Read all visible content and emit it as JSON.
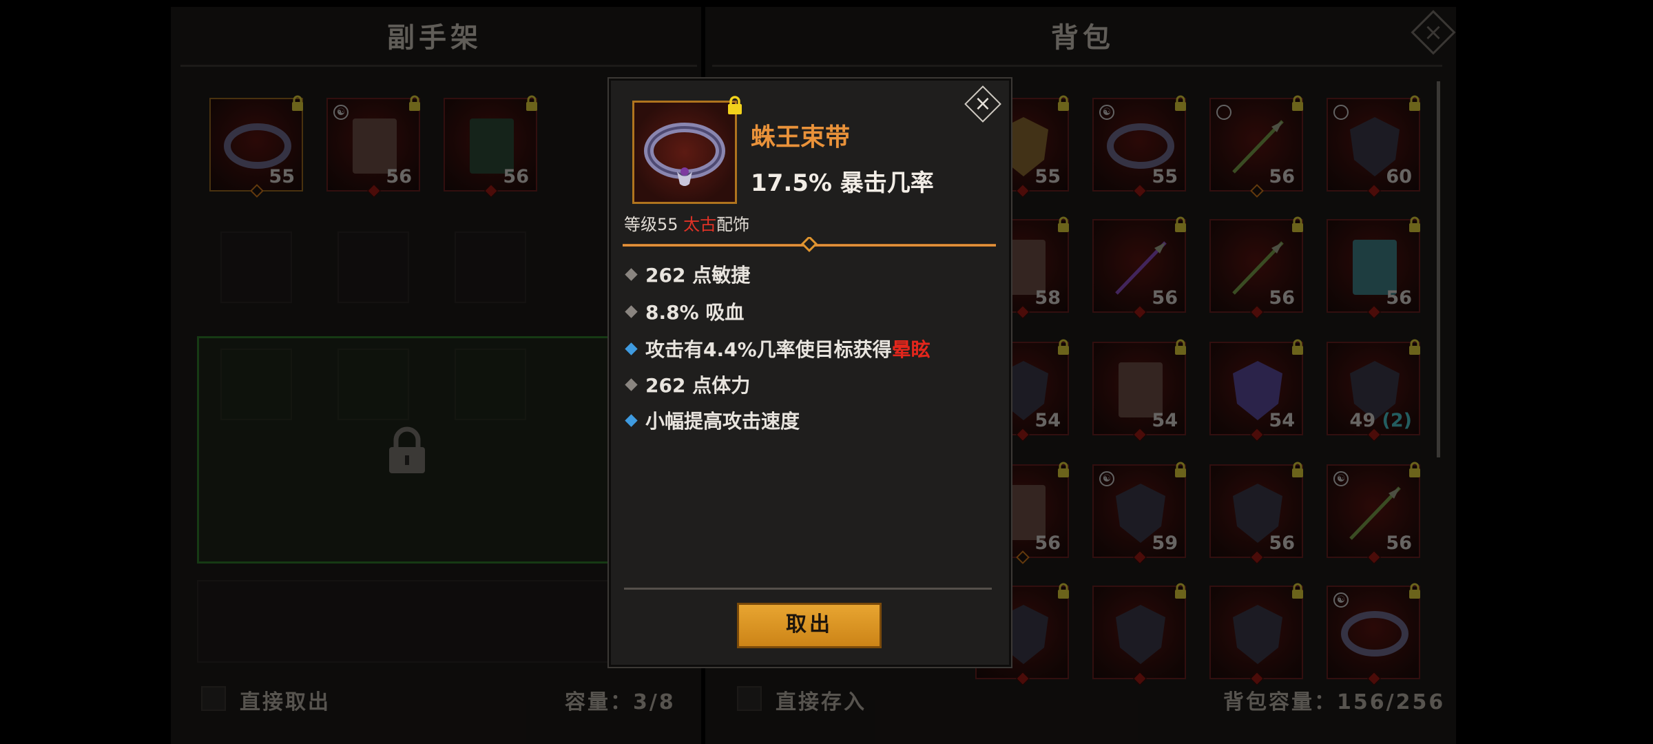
{
  "left_panel": {
    "title": "副手架",
    "items": [
      {
        "level": "55",
        "icon": "belt-icon",
        "lock": true,
        "diamond": "gold",
        "frame": "gold"
      },
      {
        "level": "56",
        "icon": "tome-icon",
        "lock": true,
        "diamond": "red",
        "yinyang": true
      },
      {
        "level": "56",
        "icon": "green-tome-icon",
        "lock": true,
        "diamond": "red"
      }
    ],
    "direct_take_label": "直接取出",
    "capacity_label": "容量：3/8",
    "locked_area_icon": "padlock-icon"
  },
  "right_panel": {
    "title": "背包",
    "rows": [
      [
        {
          "level": "55",
          "icon": "gold-armor-icon"
        },
        {
          "level": "55",
          "icon": "belt-icon",
          "yinyang": true
        },
        {
          "level": "56",
          "icon": "arrow-icon",
          "ring": true,
          "diamond": "gold"
        },
        {
          "level": "60",
          "icon": "shield-icon",
          "ring": true
        }
      ],
      [
        {
          "level": "58",
          "icon": "tome-icon"
        },
        {
          "level": "56",
          "icon": "purple-arrow-icon"
        },
        {
          "level": "56",
          "icon": "arrow-icon"
        },
        {
          "level": "56",
          "icon": "teal-tome-icon"
        }
      ],
      [
        {
          "level": "54",
          "icon": "dark-shield-icon"
        },
        {
          "level": "54",
          "icon": "orb-tome-icon"
        },
        {
          "level": "54",
          "icon": "purple-armor-icon"
        },
        {
          "level": "49",
          "extra": "(2)",
          "icon": "dark-shield-icon"
        }
      ],
      [
        {
          "level": "56",
          "icon": "tome-icon",
          "diamond": "gold"
        },
        {
          "level": "59",
          "icon": "grey-armor-icon",
          "yinyang": true
        },
        {
          "level": "56",
          "icon": "crest-shield-icon"
        },
        {
          "level": "56",
          "icon": "arrow-icon",
          "yinyang": true
        }
      ],
      [
        {
          "level": "",
          "icon": "blue-armor-icon"
        },
        {
          "level": "",
          "icon": "cloth-icon"
        },
        {
          "level": "",
          "icon": "round-shield-icon"
        },
        {
          "level": "",
          "icon": "belt-icon",
          "yinyang": true
        }
      ]
    ],
    "direct_store_label": "直接存入",
    "capacity_label": "背包容量：156/256"
  },
  "tooltip": {
    "name": "蛛王束带",
    "main_stat": "17.5% 暴击几率",
    "type_prefix": "等级55 ",
    "rarity": "太古",
    "type_suffix": "配饰",
    "properties": [
      {
        "text": "262 点敏捷",
        "bullet": "grey"
      },
      {
        "text": "8.8% 吸血",
        "bullet": "grey"
      },
      {
        "text": "攻击有4.4%几率使目标获得",
        "highlight": "晕眩",
        "bullet": "blue"
      },
      {
        "text": "262 点体力",
        "bullet": "grey"
      },
      {
        "text": "小幅提高攻击速度",
        "bullet": "blue"
      }
    ],
    "take_button": "取出",
    "close_icon": "×"
  },
  "window_close_icon": "×",
  "colors": {
    "name": "#e9923a",
    "rarity": "#e03226",
    "gold_button": "#e0a02a",
    "blue_bullet": "#3f9be0"
  }
}
